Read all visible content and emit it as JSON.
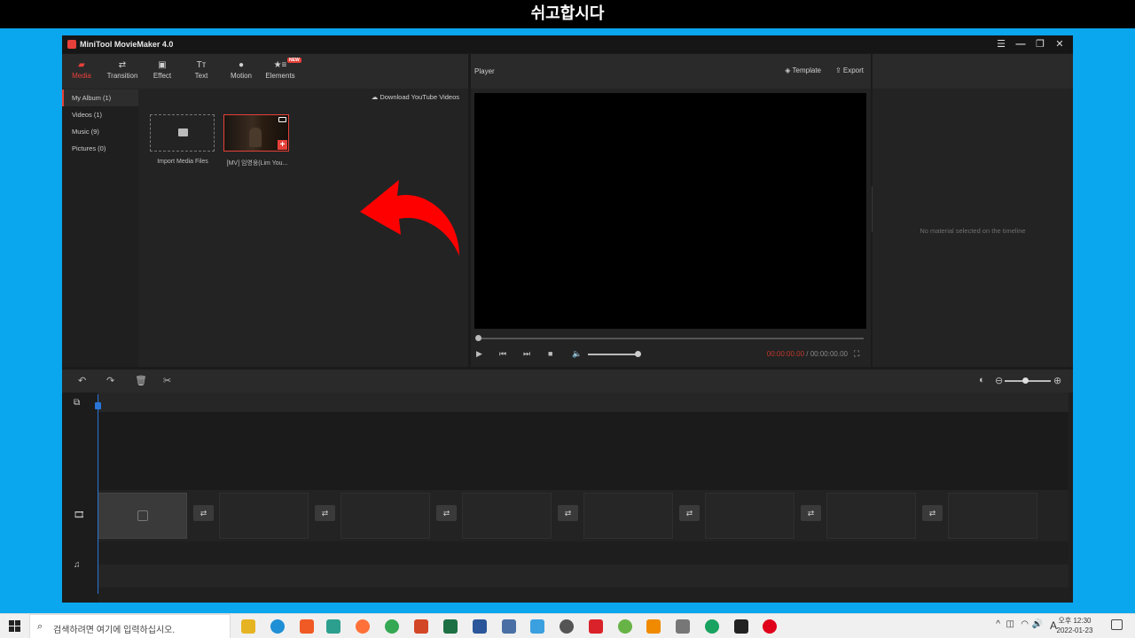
{
  "overlay": {
    "title": "쉬고합시다"
  },
  "app": {
    "title": "MiniTool MovieMaker 4.0",
    "toolbar": [
      {
        "label": "Media",
        "icon": "media-icon"
      },
      {
        "label": "Transition",
        "icon": "transition-icon"
      },
      {
        "label": "Effect",
        "icon": "effect-icon"
      },
      {
        "label": "Text",
        "icon": "text-icon"
      },
      {
        "label": "Motion",
        "icon": "motion-icon"
      },
      {
        "label": "Elements",
        "icon": "elements-icon"
      }
    ],
    "elements_badge": "NEW",
    "sidebar": [
      {
        "label": "My Album (1)"
      },
      {
        "label": "Videos (1)"
      },
      {
        "label": "Music (9)"
      },
      {
        "label": "Pictures (0)"
      }
    ],
    "download_youtube": "Download YouTube Videos",
    "import_label": "Import Media Files",
    "clip_label": "[MV] 임영웅(Lim You...",
    "player": {
      "label": "Player",
      "template": "Template",
      "export": "Export",
      "timecode_current": "00:00:00.00",
      "timecode_total": " / 00:00:00.00"
    },
    "properties_empty": "No material selected on the timeline"
  },
  "taskbar": {
    "search_placeholder": "검색하려면 여기에 입력하십시오.",
    "ime": "A",
    "time_ampm": "오후 12:30",
    "date": "2022-01-23"
  },
  "colors": {
    "accent": "#e5413a",
    "frame": "#0aa6ee",
    "playhead": "#2a74d8"
  }
}
